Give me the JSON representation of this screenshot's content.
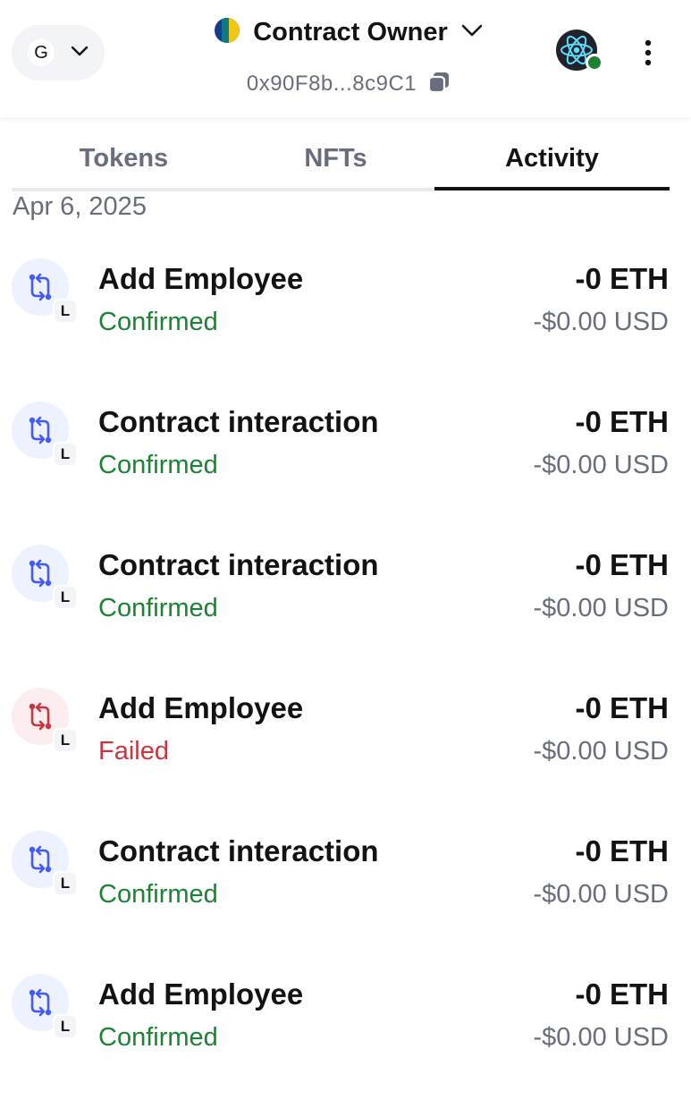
{
  "header": {
    "network_letter": "G",
    "account_name": "Contract Owner",
    "address": "0x90F8b...8c9C1",
    "icons": {
      "network_chevron": "chevron-down-icon",
      "account_chevron": "chevron-down-icon",
      "copy": "copy-icon",
      "avatar": "react-logo-icon",
      "menu": "kebab-menu-icon"
    },
    "status_color": "#1c8234"
  },
  "tabs": [
    {
      "label": "Tokens",
      "active": false
    },
    {
      "label": "NFTs",
      "active": false
    },
    {
      "label": "Activity",
      "active": true
    }
  ],
  "activity": {
    "date": "Apr 6, 2025",
    "badge": "L",
    "transactions": [
      {
        "title": "Add Employee",
        "status": "Confirmed",
        "amount": "-0 ETH",
        "fiat": "-$0.00 USD",
        "state": "ok"
      },
      {
        "title": "Contract interaction",
        "status": "Confirmed",
        "amount": "-0 ETH",
        "fiat": "-$0.00 USD",
        "state": "ok"
      },
      {
        "title": "Contract interaction",
        "status": "Confirmed",
        "amount": "-0 ETH",
        "fiat": "-$0.00 USD",
        "state": "ok"
      },
      {
        "title": "Add Employee",
        "status": "Failed",
        "amount": "-0 ETH",
        "fiat": "-$0.00 USD",
        "state": "fail"
      },
      {
        "title": "Contract interaction",
        "status": "Confirmed",
        "amount": "-0 ETH",
        "fiat": "-$0.00 USD",
        "state": "ok"
      },
      {
        "title": "Add Employee",
        "status": "Confirmed",
        "amount": "-0 ETH",
        "fiat": "-$0.00 USD",
        "state": "ok"
      }
    ]
  },
  "colors": {
    "confirmed": "#1c8234",
    "failed": "#ca3542",
    "icon_ok": "#4459ff",
    "icon_fail": "#ca3542"
  }
}
